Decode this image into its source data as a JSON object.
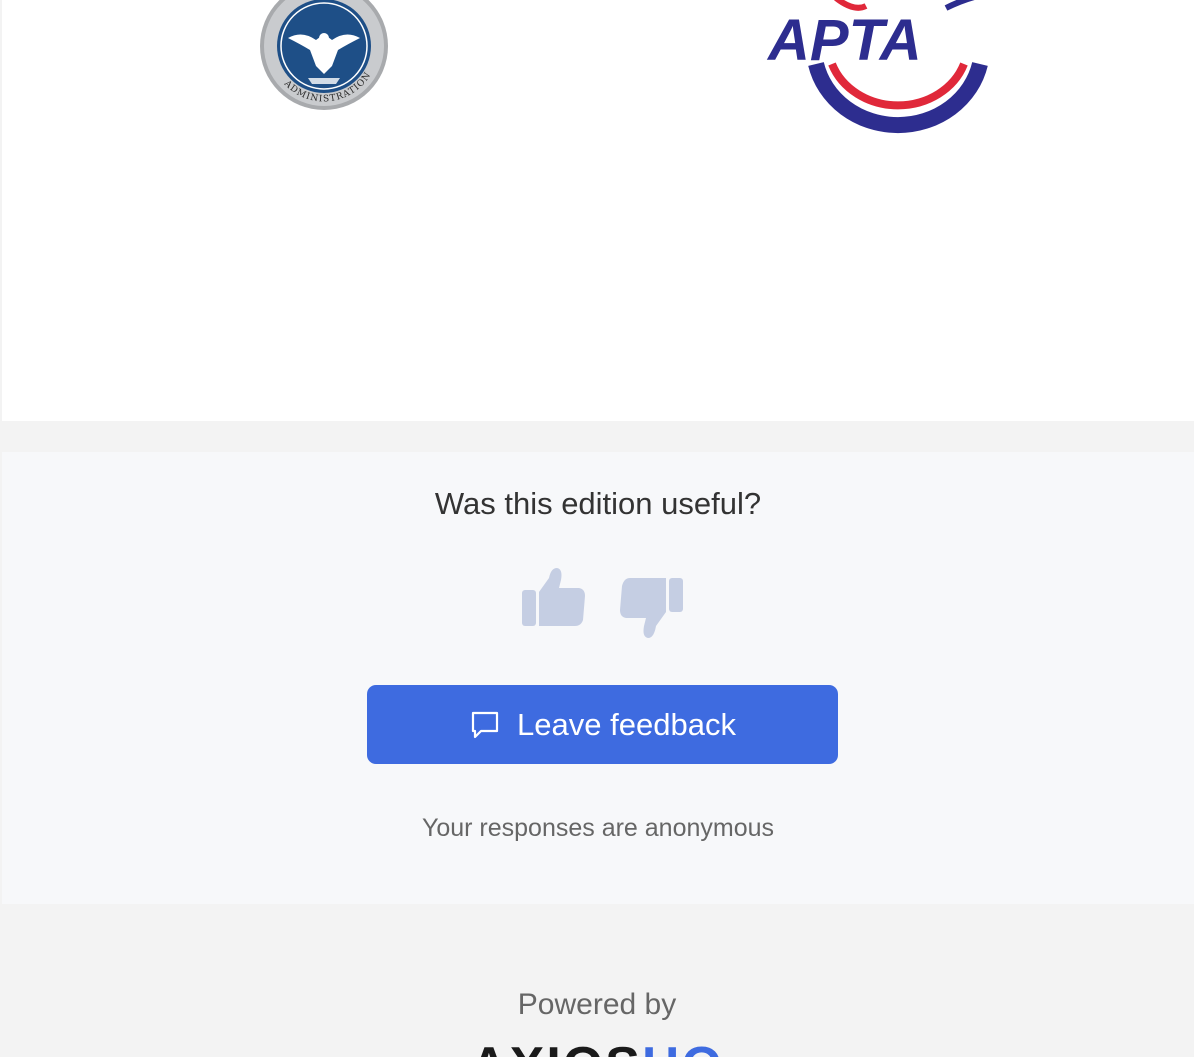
{
  "logos": {
    "tsa_seal_text": "TRANSPORTATION SECURITY ADMINISTRATION",
    "apta_text": "APTA"
  },
  "feedback": {
    "question": "Was this edition useful?",
    "leave_label": "Leave feedback",
    "note": "Your responses are anonymous",
    "icons": {
      "thumbs_up": "thumbs-up-icon",
      "thumbs_down": "thumbs-down-icon",
      "chat": "chat-bubble-icon"
    }
  },
  "footer": {
    "powered_by": "Powered by",
    "brand_main": "AXIOS",
    "brand_accent": "HQ"
  },
  "colors": {
    "accent": "#3e6be0",
    "thumb": "#c5cee3",
    "apta_blue": "#2d2d8f",
    "apta_red": "#e0283a",
    "tsa_blue": "#1e4f87"
  }
}
